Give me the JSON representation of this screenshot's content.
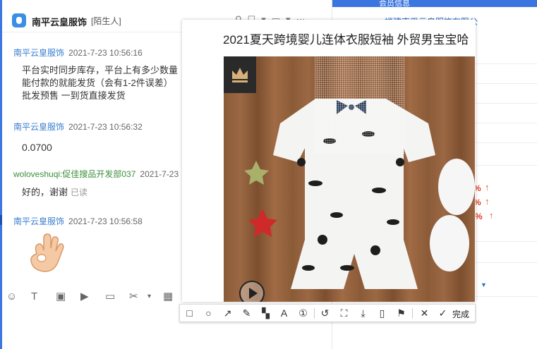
{
  "header": {
    "title": "南平云皇服饰",
    "tag": "[陌生人]"
  },
  "messages": [
    {
      "sender": "南平云皇服饰",
      "time": "2021-7-23 10:56:16",
      "lines": [
        "平台实时同步库存，平台上有多少数量",
        "能付款的就能发货（会有1-2件误差）",
        "批发预售 一到货直接发货"
      ]
    },
    {
      "sender": "南平云皇服饰",
      "time": "2021-7-23 10:56:32",
      "text": "0.0700"
    },
    {
      "sender": "woloveshuqi:促佳搜品开发部037",
      "time": "2021-7-23",
      "text": "好的，谢谢",
      "status": "已读"
    },
    {
      "sender": "南平云皇服饰",
      "time": "2021-7-23 10:56:58"
    }
  ],
  "right_panel": {
    "tab_label": "会员信息",
    "store_name": "福建南平云皇服饰有限公",
    "stat_symbol": "%"
  },
  "screenshot": {
    "title": "2021夏天跨境婴儿连体衣服短袖 外贸男宝宝哈"
  },
  "toolbar": {
    "done_label": "完成"
  },
  "colors": {
    "accent": "#3b76e0",
    "link": "#2a6fcf",
    "sender": "#3a7fd0",
    "sender_alt": "#3a8f3a",
    "stat": "#e03a2a"
  }
}
